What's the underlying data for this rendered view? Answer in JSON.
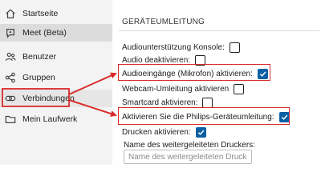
{
  "sidebar": {
    "items": [
      {
        "label": "Startseite",
        "icon": "home-icon"
      },
      {
        "label": "Meet (Beta)",
        "icon": "chat-bubble-icon"
      },
      {
        "label": "Benutzer",
        "icon": "users-icon"
      },
      {
        "label": "Gruppen",
        "icon": "share-nodes-icon"
      },
      {
        "label": "Verbindungen",
        "icon": "link-icon"
      },
      {
        "label": "Mein Laufwerk",
        "icon": "folder-icon"
      }
    ]
  },
  "section": {
    "title": "GERÄTEUMLEITUNG",
    "options": [
      {
        "label": "Audiounterstützung Konsole:",
        "checked": false
      },
      {
        "label": "Audio deaktivieren:",
        "checked": false
      },
      {
        "label": "Audioeingänge (Mikrofon) aktivieren:",
        "checked": true
      },
      {
        "label": "Webcam-Umleitung aktivieren",
        "checked": false
      },
      {
        "label": "Smartcard aktivieren:",
        "checked": false
      },
      {
        "label": "Aktivieren Sie die Philips-Geräteumleitung:",
        "checked": true
      },
      {
        "label": "Drucken aktivieren:",
        "checked": true
      }
    ],
    "printer_name": {
      "label": "Name des weitergeleiteten Druckers:",
      "placeholder": "Name des weitergeleiteten Druckers:",
      "value": ""
    }
  },
  "colors": {
    "accent": "#0b5fa5",
    "annotation": "#d92b2b",
    "sidebar_bg": "#f3f3f3"
  }
}
